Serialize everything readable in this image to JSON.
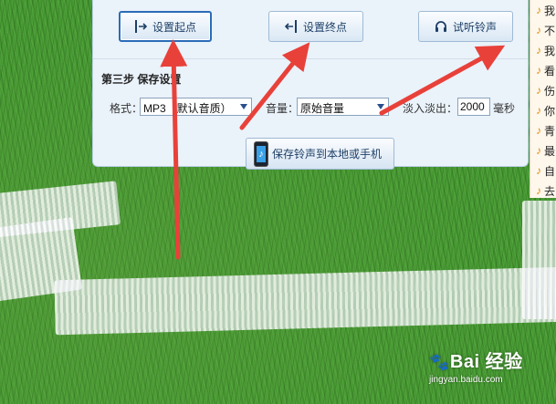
{
  "toolbar": {
    "set_start_label": "设置起点",
    "set_end_label": "设置终点",
    "preview_label": "试听铃声"
  },
  "step3": {
    "title": "第三步  保存设置",
    "format_label": "格式：",
    "format_value": "MP3（默认音质）",
    "volume_label": "音量：",
    "volume_value": "原始音量",
    "fade_label": "淡入淡出：",
    "fade_value": "2000",
    "fade_unit": "毫秒"
  },
  "save_button_label": "保存铃声到本地或手机",
  "sidebar": {
    "items": [
      {
        "label": "我"
      },
      {
        "label": "不"
      },
      {
        "label": "我"
      },
      {
        "label": "看"
      },
      {
        "label": "伤"
      },
      {
        "label": "你"
      },
      {
        "label": "青"
      },
      {
        "label": "最"
      },
      {
        "label": "自"
      },
      {
        "label": "去"
      }
    ]
  },
  "watermark": {
    "logo_text": "Bai  经验",
    "url": "jingyan.baidu.com"
  },
  "colors": {
    "arrow": "#e8413a",
    "panel_bg": "#eaf2fa",
    "button_text": "#1d3f66",
    "note_icon": "#e28a10"
  }
}
